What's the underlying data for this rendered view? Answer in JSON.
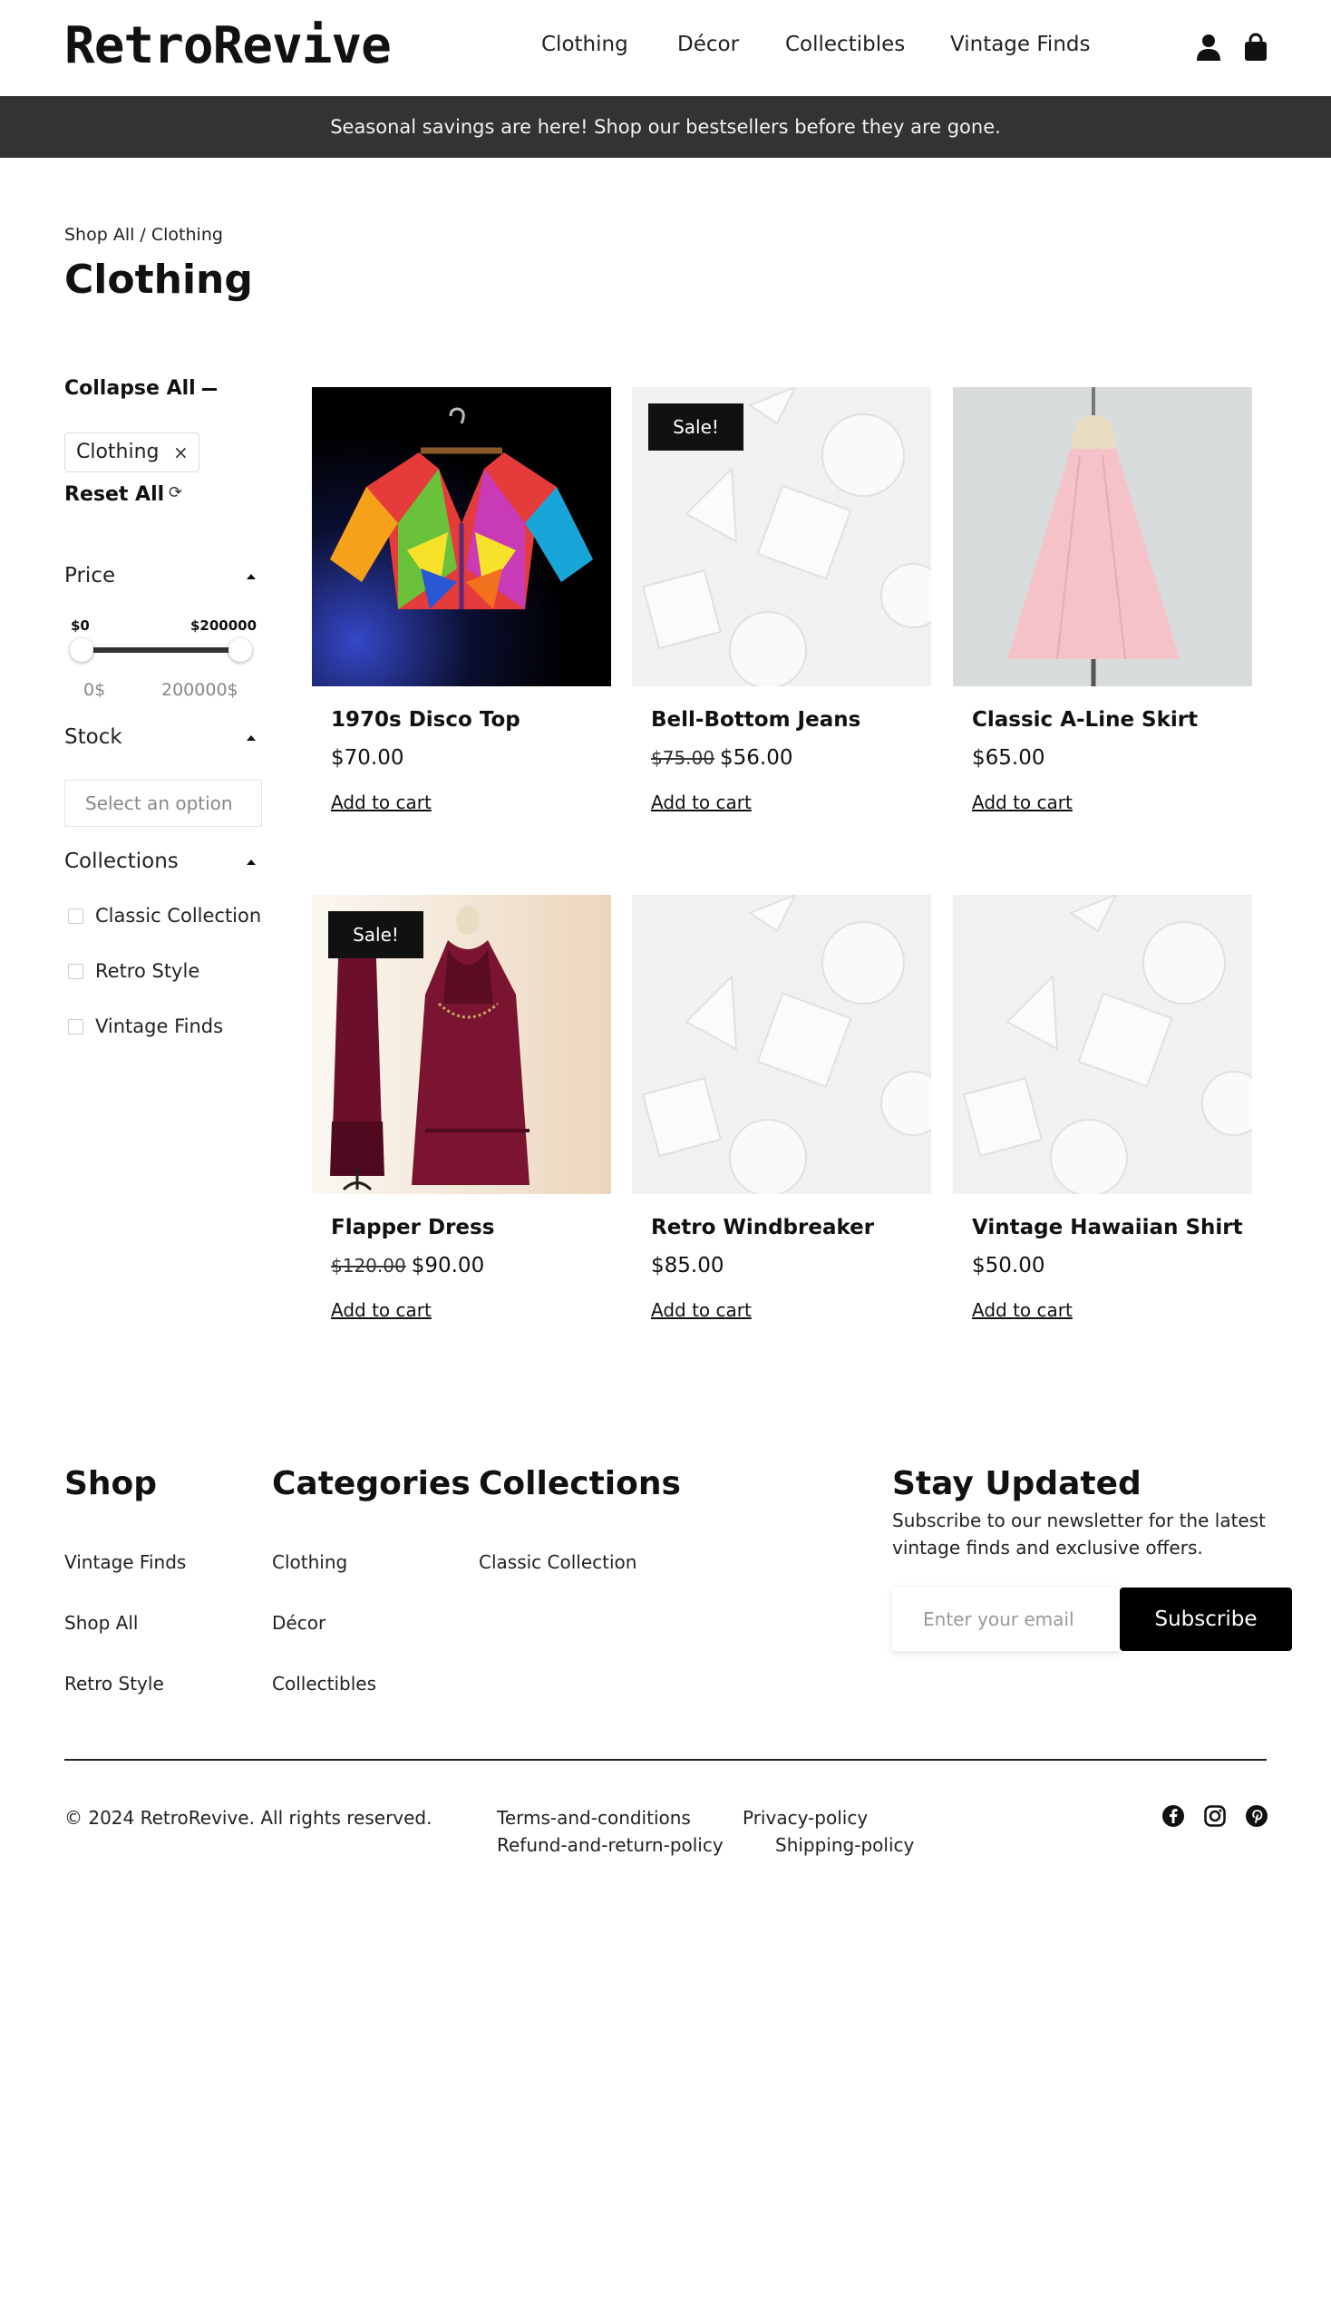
{
  "header": {
    "logo": "RetroRevive",
    "nav": [
      "Clothing",
      "Décor",
      "Collectibles",
      "Vintage Finds"
    ],
    "icons": [
      "user-icon",
      "shopping-bag-icon"
    ]
  },
  "announcement": "Seasonal savings are here! Shop our bestsellers before they are gone.",
  "breadcrumb": {
    "root": "Shop All",
    "separator": " / ",
    "current": "Clothing"
  },
  "page_title": "Clothing",
  "sidebar": {
    "collapse_all": "Collapse All",
    "active_filter": "Clothing",
    "active_filter_remove": "×",
    "reset_all": "Reset All",
    "price": {
      "label": "Price",
      "min_label": "$0",
      "max_label": "$200000",
      "min_value": "0$",
      "max_value": "200000$"
    },
    "stock": {
      "label": "Stock",
      "placeholder": "Select an option"
    },
    "collections": {
      "label": "Collections",
      "options": [
        "Classic Collection",
        "Retro Style",
        "Vintage Finds"
      ]
    }
  },
  "products": [
    {
      "name": "1970s Disco Top",
      "price": "$70.00",
      "old_price": "",
      "sale": false,
      "sale_label": "",
      "image": "disco-top-photo",
      "cta": "Add to cart"
    },
    {
      "name": "Bell-Bottom Jeans",
      "price": "$56.00",
      "old_price": "$75.00",
      "sale": true,
      "sale_label": "Sale!",
      "image": "placeholder-geometric",
      "cta": "Add to cart"
    },
    {
      "name": "Classic A-Line Skirt",
      "price": "$65.00",
      "old_price": "",
      "sale": false,
      "sale_label": "",
      "image": "a-line-skirt-photo",
      "cta": "Add to cart"
    },
    {
      "name": "Flapper Dress",
      "price": "$90.00",
      "old_price": "$120.00",
      "sale": true,
      "sale_label": "Sale!",
      "image": "flapper-dress-photo",
      "cta": "Add to cart"
    },
    {
      "name": "Retro Windbreaker",
      "price": "$85.00",
      "old_price": "",
      "sale": false,
      "sale_label": "",
      "image": "placeholder-geometric",
      "cta": "Add to cart"
    },
    {
      "name": "Vintage Hawaiian Shirt",
      "price": "$50.00",
      "old_price": "",
      "sale": false,
      "sale_label": "",
      "image": "placeholder-geometric",
      "cta": "Add to cart"
    }
  ],
  "footer": {
    "shop": {
      "heading": "Shop",
      "links": [
        "Vintage Finds",
        "Shop All",
        "Retro Style"
      ]
    },
    "categories": {
      "heading": "Categories",
      "links": [
        "Clothing",
        "Décor",
        "Collectibles"
      ]
    },
    "collections": {
      "heading": "Collections",
      "links": [
        "Classic Collection"
      ]
    },
    "newsletter": {
      "heading": "Stay Updated",
      "text": "Subscribe to our newsletter for the latest vintage finds and exclusive offers.",
      "placeholder": "Enter your email",
      "button": "Subscribe"
    },
    "copyright": "© 2024 RetroRevive. All rights reserved.",
    "legal": [
      "Terms-and-conditions",
      "Privacy-policy",
      "Refund-and-return-policy",
      "Shipping-policy"
    ],
    "social": [
      "facebook-icon",
      "instagram-icon",
      "pinterest-icon"
    ]
  }
}
